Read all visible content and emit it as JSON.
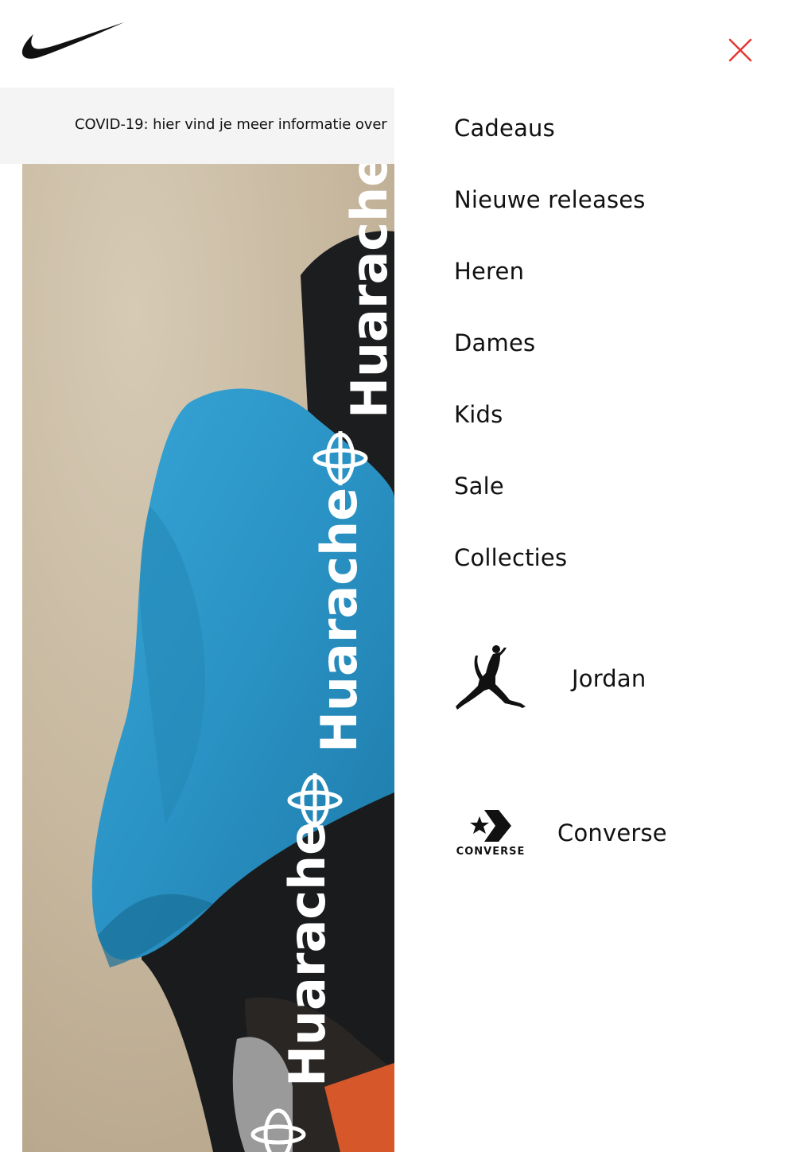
{
  "header": {
    "logo": "nike-swoosh",
    "close_label": "Close menu",
    "close_color": "#e53935"
  },
  "banner": {
    "text": "COVID-19: hier vind je meer informatie over"
  },
  "hero": {
    "overlay_text": "Huarache"
  },
  "menu": {
    "items": [
      {
        "label": "Cadeaus"
      },
      {
        "label": "Nieuwe releases"
      },
      {
        "label": "Heren"
      },
      {
        "label": "Dames"
      },
      {
        "label": "Kids"
      },
      {
        "label": "Sale"
      },
      {
        "label": "Collecties"
      }
    ],
    "brands": [
      {
        "label": "Jordan",
        "icon": "jumpman-logo"
      },
      {
        "label": "Converse",
        "icon": "converse-logo",
        "logo_text": "CONVERSE"
      }
    ]
  },
  "colors": {
    "text": "#111111",
    "banner_bg": "#f4f4f4",
    "hoodie_blue": "#2e9ccc",
    "close_red": "#e53935"
  }
}
